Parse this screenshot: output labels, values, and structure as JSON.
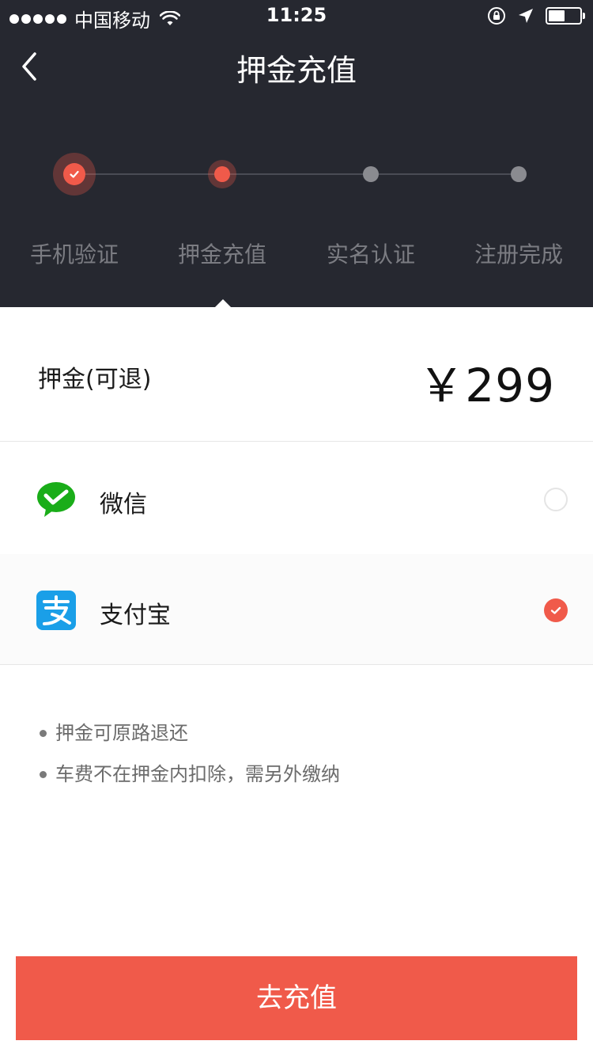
{
  "status_bar": {
    "carrier": "中国移动",
    "time": "11:25"
  },
  "nav": {
    "title": "押金充值"
  },
  "steps": {
    "items": [
      {
        "label": "手机验证",
        "state": "done"
      },
      {
        "label": "押金充值",
        "state": "current"
      },
      {
        "label": "实名认证",
        "state": "todo"
      },
      {
        "label": "注册完成",
        "state": "todo"
      }
    ]
  },
  "deposit": {
    "label": "押金(可退)",
    "amount": "￥299"
  },
  "payment": {
    "options": [
      {
        "name": "微信",
        "icon": "wechat-icon",
        "selected": false
      },
      {
        "name": "支付宝",
        "icon": "alipay-icon",
        "selected": true
      }
    ]
  },
  "notes": [
    "押金可原路退还",
    "车费不在押金内扣除，需另外缴纳"
  ],
  "cta": {
    "label": "去充值"
  },
  "colors": {
    "header_bg": "#262830",
    "accent": "#f05a4a",
    "wechat_green": "#1aad19",
    "alipay_blue": "#1a9fe8"
  }
}
